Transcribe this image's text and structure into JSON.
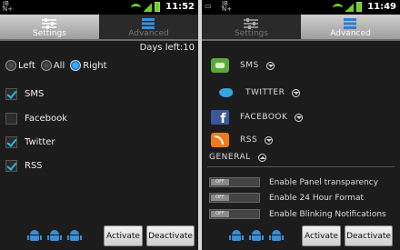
{
  "status": {
    "left": {
      "carrier": "JB\nN+",
      "time": "11:52"
    },
    "right": {
      "carrier": "JB\nN+",
      "time": "11:49"
    }
  },
  "tabs": {
    "settings": "Settings",
    "advanced": "Advanced"
  },
  "settings": {
    "days_left": "Days left:10",
    "radios": [
      {
        "label": "Left",
        "selected": false
      },
      {
        "label": "All",
        "selected": false
      },
      {
        "label": "Right",
        "selected": true
      }
    ],
    "checks": [
      {
        "label": "SMS",
        "checked": true
      },
      {
        "label": "Facebook",
        "checked": false
      },
      {
        "label": "Twitter",
        "checked": true
      },
      {
        "label": "RSS",
        "checked": true
      }
    ]
  },
  "advanced": {
    "networks": [
      {
        "label": "SMS",
        "icon": "sms-icon"
      },
      {
        "label": "TWITTER",
        "icon": "twitter-icon"
      },
      {
        "label": "FACEBOOK",
        "icon": "facebook-icon"
      },
      {
        "label": "RSS",
        "icon": "rss-icon"
      }
    ],
    "general_label": "GENERAL",
    "toggles": [
      {
        "state": "OFF",
        "label": "Enable Panel transparency"
      },
      {
        "state": "OFF",
        "label": "Enable 24 Hour Format"
      },
      {
        "state": "OFF",
        "label": "Enable Blinking Notifications"
      }
    ]
  },
  "buttons": {
    "activate": "Activate",
    "deactivate": "Deactivate"
  },
  "colors": {
    "accent": "#33b5e5",
    "radio_on": "#3aa8ff",
    "status_green": "#6ccf2a"
  }
}
